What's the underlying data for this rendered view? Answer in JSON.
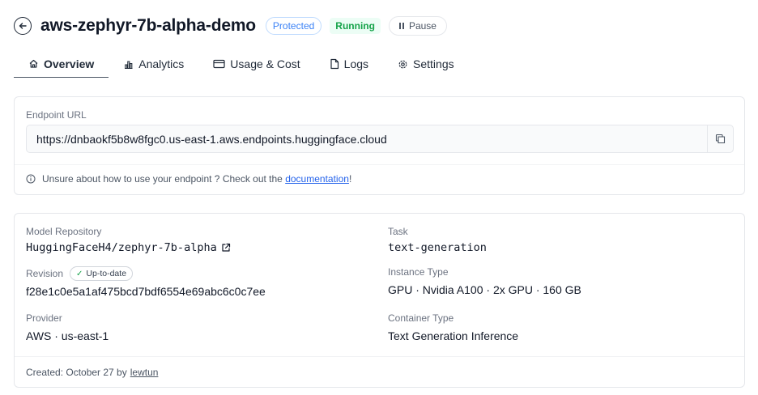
{
  "header": {
    "title": "aws-zephyr-7b-alpha-demo",
    "badge_protected": "Protected",
    "badge_running": "Running",
    "pause_label": "Pause"
  },
  "tabs": [
    {
      "label": "Overview",
      "icon": "home-icon"
    },
    {
      "label": "Analytics",
      "icon": "analytics-icon"
    },
    {
      "label": "Usage & Cost",
      "icon": "credit-card-icon"
    },
    {
      "label": "Logs",
      "icon": "file-icon"
    },
    {
      "label": "Settings",
      "icon": "gear-icon"
    }
  ],
  "endpoint": {
    "label": "Endpoint URL",
    "url": "https://dnbaokf5b8w8fgc0.us-east-1.aws.endpoints.huggingface.cloud",
    "hint_prefix": "Unsure about how to use your endpoint ? Check out the",
    "hint_link": "documentation",
    "hint_suffix": "!"
  },
  "details": {
    "model_repo_label": "Model Repository",
    "model_repo_value": "HuggingFaceH4/zephyr-7b-alpha",
    "revision_label": "Revision",
    "revision_badge": "Up-to-date",
    "revision_value": "f28e1c0e5a1af475bcd7bdf6554e69abc6c0c7ee",
    "provider_label": "Provider",
    "provider_value": "AWS · us-east-1",
    "task_label": "Task",
    "task_value": "text-generation",
    "instance_label": "Instance Type",
    "instance_value": "GPU · Nvidia A100 · 2x GPU · 160 GB",
    "container_label": "Container Type",
    "container_value": "Text Generation Inference"
  },
  "footer": {
    "created_prefix": "Created: October 27 by",
    "created_user": "lewtun"
  },
  "colors": {
    "accent_blue": "#3b82f6",
    "running_green": "#16a34a",
    "link_blue": "#2563eb"
  }
}
